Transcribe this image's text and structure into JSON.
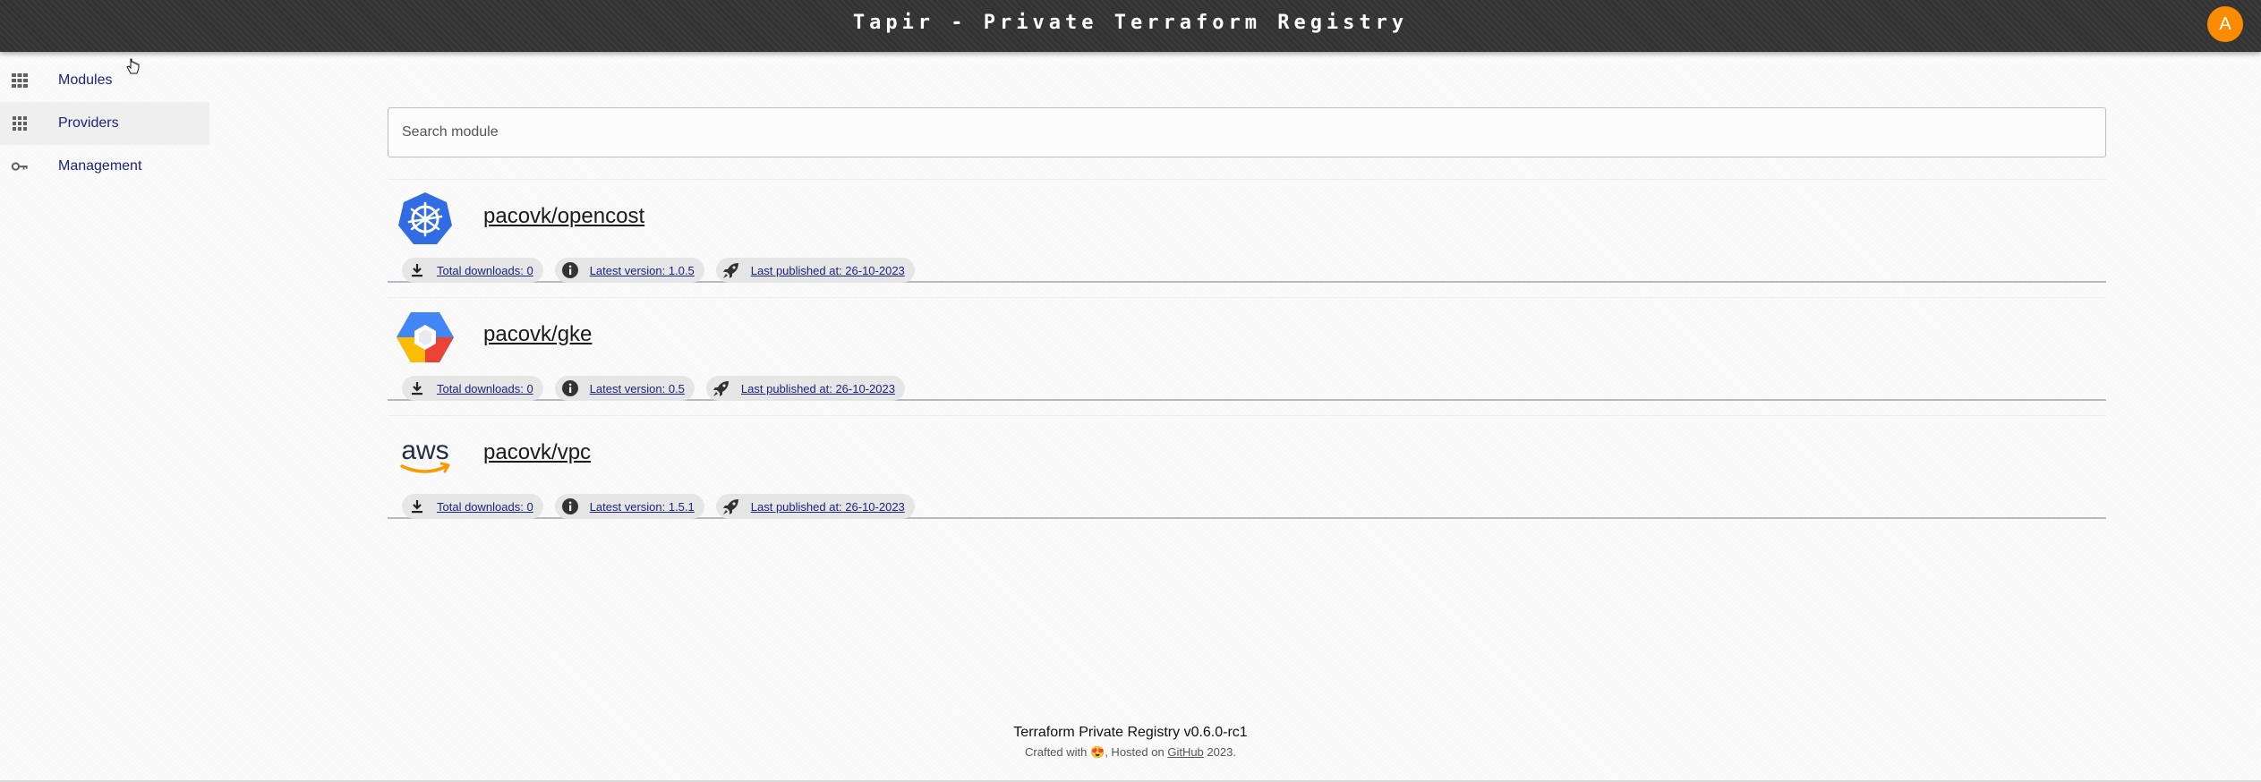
{
  "header": {
    "title": "Tapir - Private Terraform Registry",
    "avatar_letter": "A"
  },
  "sidebar": {
    "items": [
      {
        "label": "Modules",
        "icon": "grid-icon"
      },
      {
        "label": "Providers",
        "icon": "apps-icon"
      },
      {
        "label": "Management",
        "icon": "key-icon"
      }
    ]
  },
  "search": {
    "placeholder": "Search module",
    "value": ""
  },
  "modules": [
    {
      "name": "pacovk/opencost",
      "logo": "kubernetes-logo",
      "downloads": "Total downloads: 0",
      "version": "Latest version: 1.0.5",
      "published": "Last published at: 26-10-2023"
    },
    {
      "name": "pacovk/gke",
      "logo": "google-kubernetes-engine-logo",
      "downloads": "Total downloads: 0",
      "version": "Latest version: 0.5",
      "published": "Last published at: 26-10-2023"
    },
    {
      "name": "pacovk/vpc",
      "logo": "aws-logo",
      "logo_text": "aws",
      "downloads": "Total downloads: 0",
      "version": "Latest version: 1.5.1",
      "published": "Last published at: 26-10-2023"
    }
  ],
  "footer": {
    "title": "Terraform Private Registry v0.6.0-rc1",
    "crafted_prefix": "Crafted with",
    "emoji": "😍",
    "hosted_text": ", Hosted on",
    "github_link": "GitHub",
    "year_suffix": "2023."
  },
  "colors": {
    "topbar": "#333333",
    "accent_avatar": "#fb8c00",
    "nav_text": "#1a237e",
    "chip_bg": "#e6e6e6"
  }
}
